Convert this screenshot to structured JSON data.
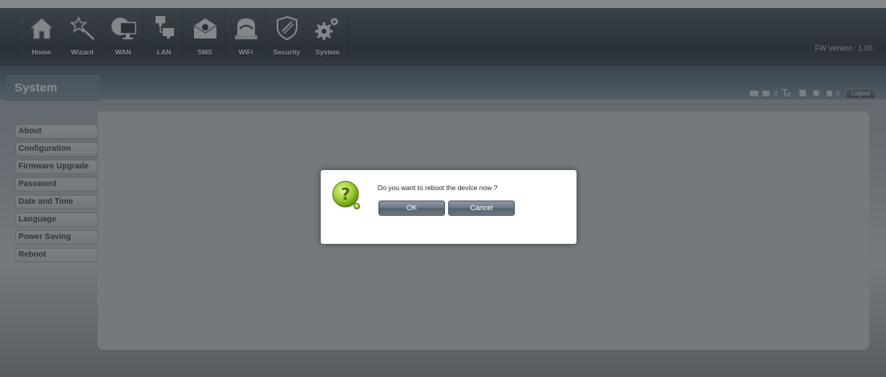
{
  "nav": {
    "items": [
      {
        "label": "Home",
        "icon": "home-icon"
      },
      {
        "label": "Wizard",
        "icon": "wizard-icon"
      },
      {
        "label": "WAN",
        "icon": "wan-icon"
      },
      {
        "label": "LAN",
        "icon": "lan-icon"
      },
      {
        "label": "SMS",
        "icon": "sms-icon"
      },
      {
        "label": "WiFi",
        "icon": "wifi-icon"
      },
      {
        "label": "Security",
        "icon": "security-icon"
      },
      {
        "label": "System",
        "icon": "system-icon"
      }
    ],
    "fw_version": "FW Version : 1.00"
  },
  "section": {
    "title": "System"
  },
  "status": {
    "sms_count": "0",
    "msg_count": "0",
    "logout_label": "Logout"
  },
  "sidebar": {
    "items": [
      {
        "label": "About"
      },
      {
        "label": "Configuration"
      },
      {
        "label": "Firmware Upgrade"
      },
      {
        "label": "Password"
      },
      {
        "label": "Date and Time"
      },
      {
        "label": "Language"
      },
      {
        "label": "Power Saving"
      },
      {
        "label": "Reboot"
      }
    ]
  },
  "dialog": {
    "message": "Do you want to reboot the device now ?",
    "ok_label": "OK",
    "cancel_label": "Cancel",
    "icon": "question-icon"
  },
  "colors": {
    "nav_bg": "#3a4651",
    "button": "#6a7884",
    "accent_green": "#8bbf2a"
  }
}
